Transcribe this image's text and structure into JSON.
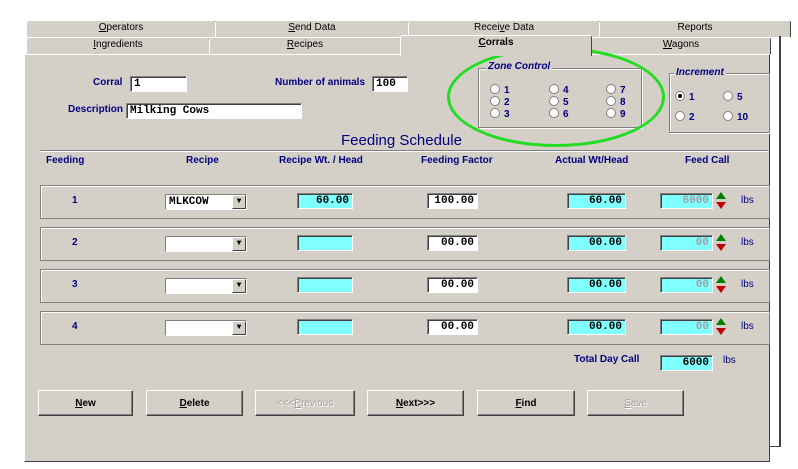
{
  "tabs_back": [
    {
      "label": "Operators",
      "ukey": "O",
      "rest": "perators"
    },
    {
      "label": "Send Data",
      "ukey": "S",
      "rest": "end Data"
    },
    {
      "label": "Receive Data",
      "pre": "Recei",
      "ukey": "v",
      "rest": "e Data"
    },
    {
      "label": "Reports",
      "ukey": "",
      "rest": "Reports"
    }
  ],
  "tabs_front": [
    {
      "label": "Ingredients",
      "ukey": "I",
      "rest": "ngredients"
    },
    {
      "label": "Recipes",
      "ukey": "R",
      "rest": "ecipes"
    },
    {
      "label": "Corrals",
      "ukey": "C",
      "rest": "orrals"
    },
    {
      "label": "Wagons",
      "ukey": "W",
      "rest": "agons"
    }
  ],
  "corral": {
    "corral_label": "Corral",
    "corral_value": "1",
    "animals_label": "Number of animals",
    "animals_value": "100",
    "description_label": "Description",
    "description_value": "Milking Cows"
  },
  "zone_control": {
    "title": "Zone Control",
    "options": [
      "1",
      "2",
      "3",
      "4",
      "5",
      "6",
      "7",
      "8",
      "9"
    ]
  },
  "increment": {
    "title": "Increment",
    "options": [
      "1",
      "5",
      "2",
      "10"
    ],
    "selected": "1"
  },
  "schedule": {
    "title": "Feeding Schedule",
    "headers": [
      "Feeding",
      "Recipe",
      "Recipe Wt. / Head",
      "Feeding Factor",
      "Actual Wt/Head",
      "Feed Call"
    ],
    "unit": "lbs",
    "rows": [
      {
        "feeding": "1",
        "recipe": "MLKCOW",
        "recipe_wt": "60.00",
        "factor": "100.00",
        "actual": "60.00",
        "feed_call": "6000"
      },
      {
        "feeding": "2",
        "recipe": "",
        "recipe_wt": "",
        "factor": "00.00",
        "actual": "00.00",
        "feed_call": "00"
      },
      {
        "feeding": "3",
        "recipe": "",
        "recipe_wt": "",
        "factor": "00.00",
        "actual": "00.00",
        "feed_call": "00"
      },
      {
        "feeding": "4",
        "recipe": "",
        "recipe_wt": "",
        "factor": "00.00",
        "actual": "00.00",
        "feed_call": "00"
      }
    ],
    "total_label": "Total Day Call",
    "total_value": "6000",
    "total_unit": "lbs"
  },
  "buttons": {
    "new": {
      "u": "N",
      "rest": "ew"
    },
    "delete": {
      "u": "D",
      "rest": "elete"
    },
    "previous": {
      "pre": "<<<",
      "u": "P",
      "rest": "revious"
    },
    "next": {
      "u": "N",
      "rest": "ext>>>"
    },
    "find": {
      "u": "F",
      "rest": "ind"
    },
    "save": {
      "u": "S",
      "rest": "ave"
    }
  },
  "colors": {
    "panel": "#d4d0c8",
    "label": "#000080",
    "cyan_field": "#80ffff",
    "highlight_ring": "#22dd22"
  }
}
